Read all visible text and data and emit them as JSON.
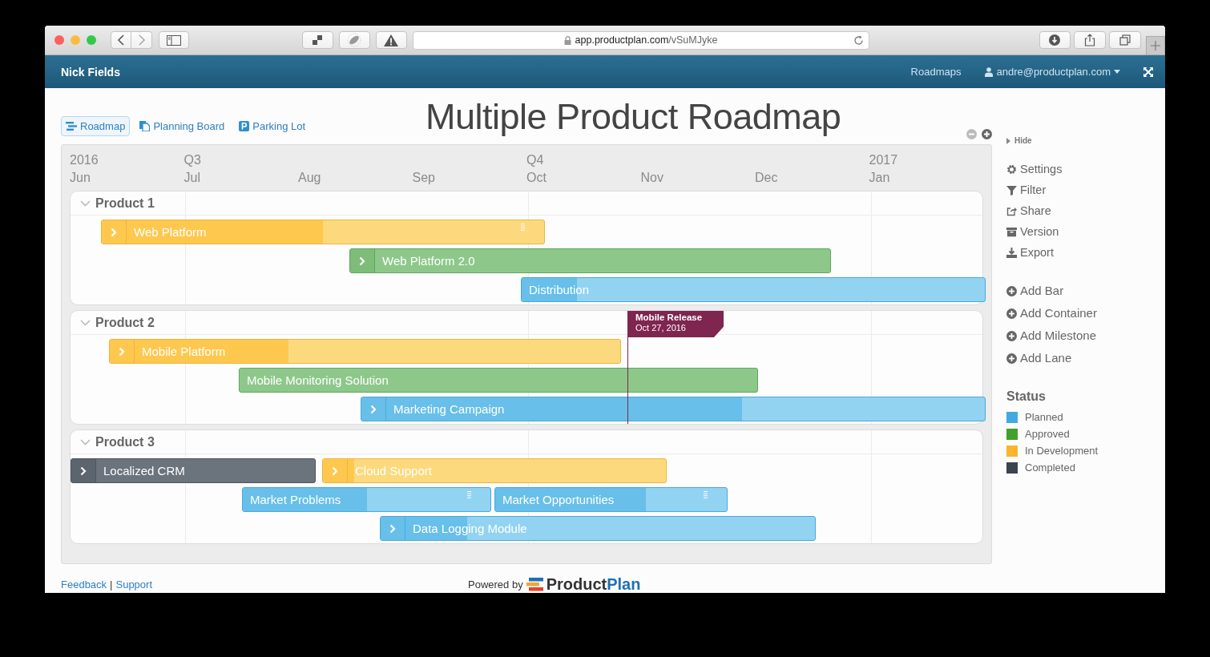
{
  "browser": {
    "url_host": "app.productplan.com",
    "url_path": "/vSuMJyke"
  },
  "navbar": {
    "account": "Nick Fields",
    "links": [
      "Roadmaps"
    ],
    "user": "andre@productplan.com"
  },
  "views": [
    {
      "label": "Roadmap",
      "selected": true
    },
    {
      "label": "Planning Board",
      "selected": false
    },
    {
      "label": "Parking Lot",
      "selected": false
    }
  ],
  "title": "Multiple Product Roadmap",
  "timeline": {
    "months": [
      {
        "name": "Jun",
        "marker": "2016"
      },
      {
        "name": "Jul",
        "marker": "Q3"
      },
      {
        "name": "Aug"
      },
      {
        "name": "Sep"
      },
      {
        "name": "Oct",
        "marker": "Q4"
      },
      {
        "name": "Nov"
      },
      {
        "name": "Dec"
      },
      {
        "name": "Jan",
        "marker": "2017"
      }
    ]
  },
  "lanes": [
    {
      "name": "Product 1",
      "expanded": true,
      "rows": [
        [
          {
            "label": "Web Platform",
            "kind": "development",
            "level": 0.5,
            "chevron": true,
            "grip": true
          }
        ],
        [
          {
            "label": "Web Platform 2.0",
            "kind": "approved",
            "chevron": true,
            "grip": false
          }
        ],
        [
          {
            "label": "Distribution",
            "kind": "planned",
            "level": 0.12,
            "chevron": false,
            "grip": false
          }
        ]
      ]
    },
    {
      "name": "Product 2",
      "expanded": true,
      "milestone": {
        "title": "Mobile Release",
        "date": "Oct 27, 2016",
        "color": "#7e2550"
      },
      "rows": [
        [
          {
            "label": "Mobile Platform",
            "kind": "development",
            "level": 0.35,
            "chevron": true,
            "grip": false
          }
        ],
        [
          {
            "label": "Mobile Monitoring Solution",
            "kind": "approved",
            "chevron": false,
            "grip": false
          }
        ],
        [
          {
            "label": "Marketing Campaign",
            "kind": "planned",
            "level": 0.61,
            "chevron": true,
            "grip": false
          }
        ]
      ]
    },
    {
      "name": "Product 3",
      "expanded": true,
      "rows": [
        [
          {
            "label": "Localized CRM",
            "kind": "completed",
            "chevron": true,
            "grip": false
          },
          {
            "label": "Cloud Support",
            "kind": "development",
            "level": 0.09,
            "chevron": true,
            "grip": false
          }
        ],
        [
          {
            "label": "Market Problems",
            "kind": "planned",
            "level": 0.5,
            "chevron": false,
            "grip": true
          },
          {
            "label": "Market Opportunities",
            "kind": "planned",
            "level": 0.65,
            "chevron": false,
            "grip": true
          }
        ],
        [
          {
            "label": "Data Logging Module",
            "kind": "planned",
            "level": 0.2,
            "chevron": true,
            "grip": false
          }
        ]
      ]
    }
  ],
  "sidebar": {
    "hide": "Hide",
    "tools": [
      "Settings",
      "Filter",
      "Share",
      "Version",
      "Export"
    ],
    "add": [
      "Add Bar",
      "Add Container",
      "Add Milestone",
      "Add Lane"
    ],
    "status_title": "Status",
    "legend": [
      {
        "label": "Planned",
        "color": "#44a9e0"
      },
      {
        "label": "Approved",
        "color": "#44a02c"
      },
      {
        "label": "In Development",
        "color": "#fbb62d"
      },
      {
        "label": "Completed",
        "color": "#3b4450"
      }
    ]
  },
  "footer": {
    "links": [
      "Feedback",
      "Support"
    ],
    "separator": "|",
    "powered_by": "Powered by",
    "brand": [
      "Product",
      "Plan"
    ]
  }
}
